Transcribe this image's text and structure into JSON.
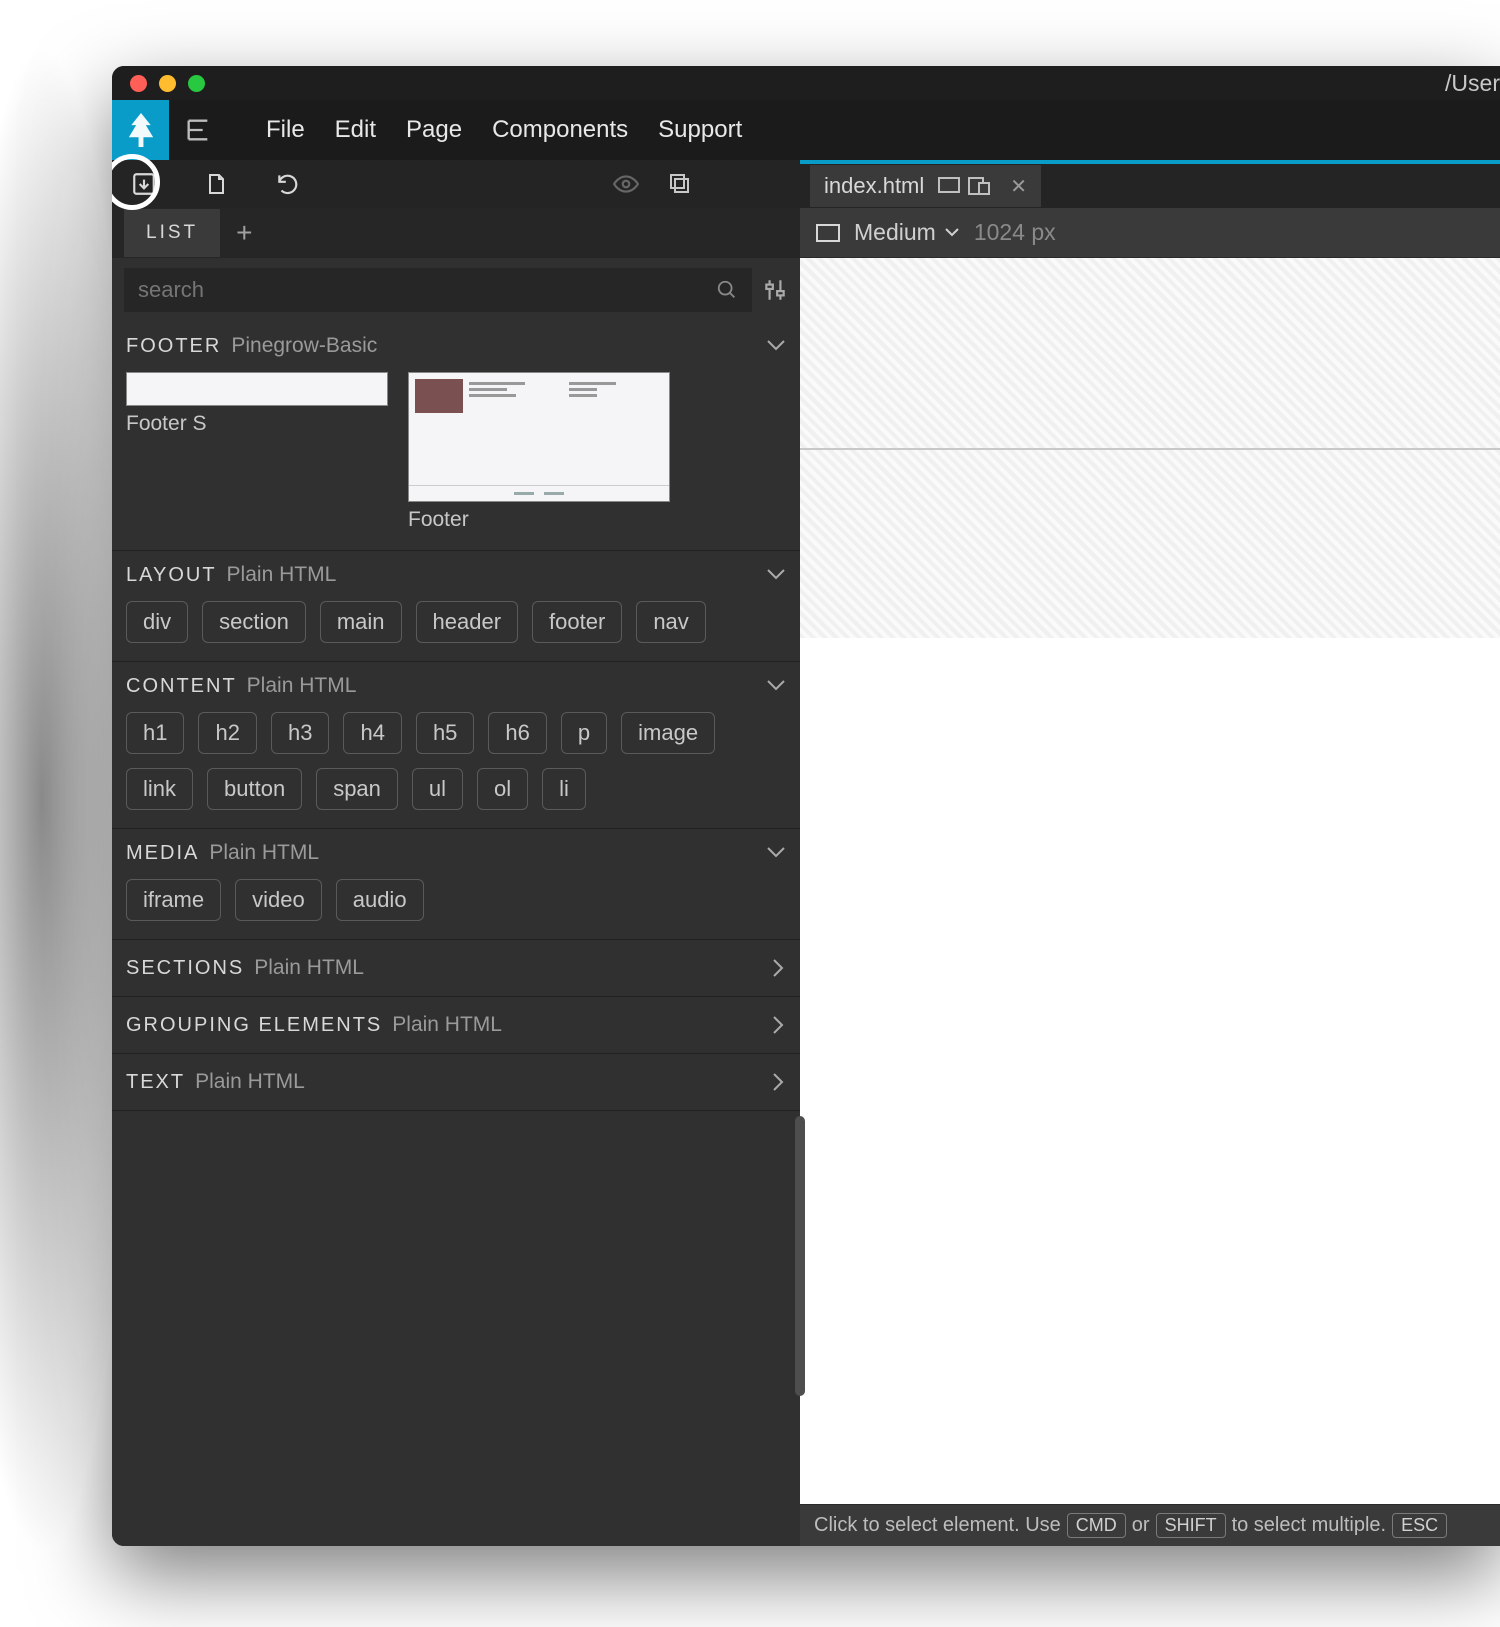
{
  "title_path": "/User",
  "menu": [
    "File",
    "Edit",
    "Page",
    "Components",
    "Support"
  ],
  "panel_tab": "LIST",
  "search": {
    "placeholder": "search"
  },
  "sections": {
    "footer": {
      "name": "FOOTER",
      "sub": "Pinegrow-Basic",
      "items": [
        "Footer S",
        "Footer"
      ]
    },
    "layout": {
      "name": "LAYOUT",
      "sub": "Plain HTML",
      "chips": [
        "div",
        "section",
        "main",
        "header",
        "footer",
        "nav"
      ]
    },
    "content": {
      "name": "CONTENT",
      "sub": "Plain HTML",
      "chips": [
        "h1",
        "h2",
        "h3",
        "h4",
        "h5",
        "h6",
        "p",
        "image",
        "link",
        "button",
        "span",
        "ul",
        "ol",
        "li"
      ]
    },
    "media": {
      "name": "MEDIA",
      "sub": "Plain HTML",
      "chips": [
        "iframe",
        "video",
        "audio"
      ]
    },
    "sections_row": {
      "name": "SECTIONS",
      "sub": "Plain HTML"
    },
    "grouping": {
      "name": "GROUPING ELEMENTS",
      "sub": "Plain HTML"
    },
    "text_row": {
      "name": "TEXT",
      "sub": "Plain HTML"
    }
  },
  "file_tab": {
    "name": "index.html"
  },
  "viewport": {
    "breakpoint": "Medium",
    "size": "1024 px"
  },
  "status": {
    "prefix": "Click to select element. Use",
    "key1": "CMD",
    "mid": "or",
    "key2": "SHIFT",
    "suffix": "to select multiple.",
    "key3": "ESC"
  }
}
